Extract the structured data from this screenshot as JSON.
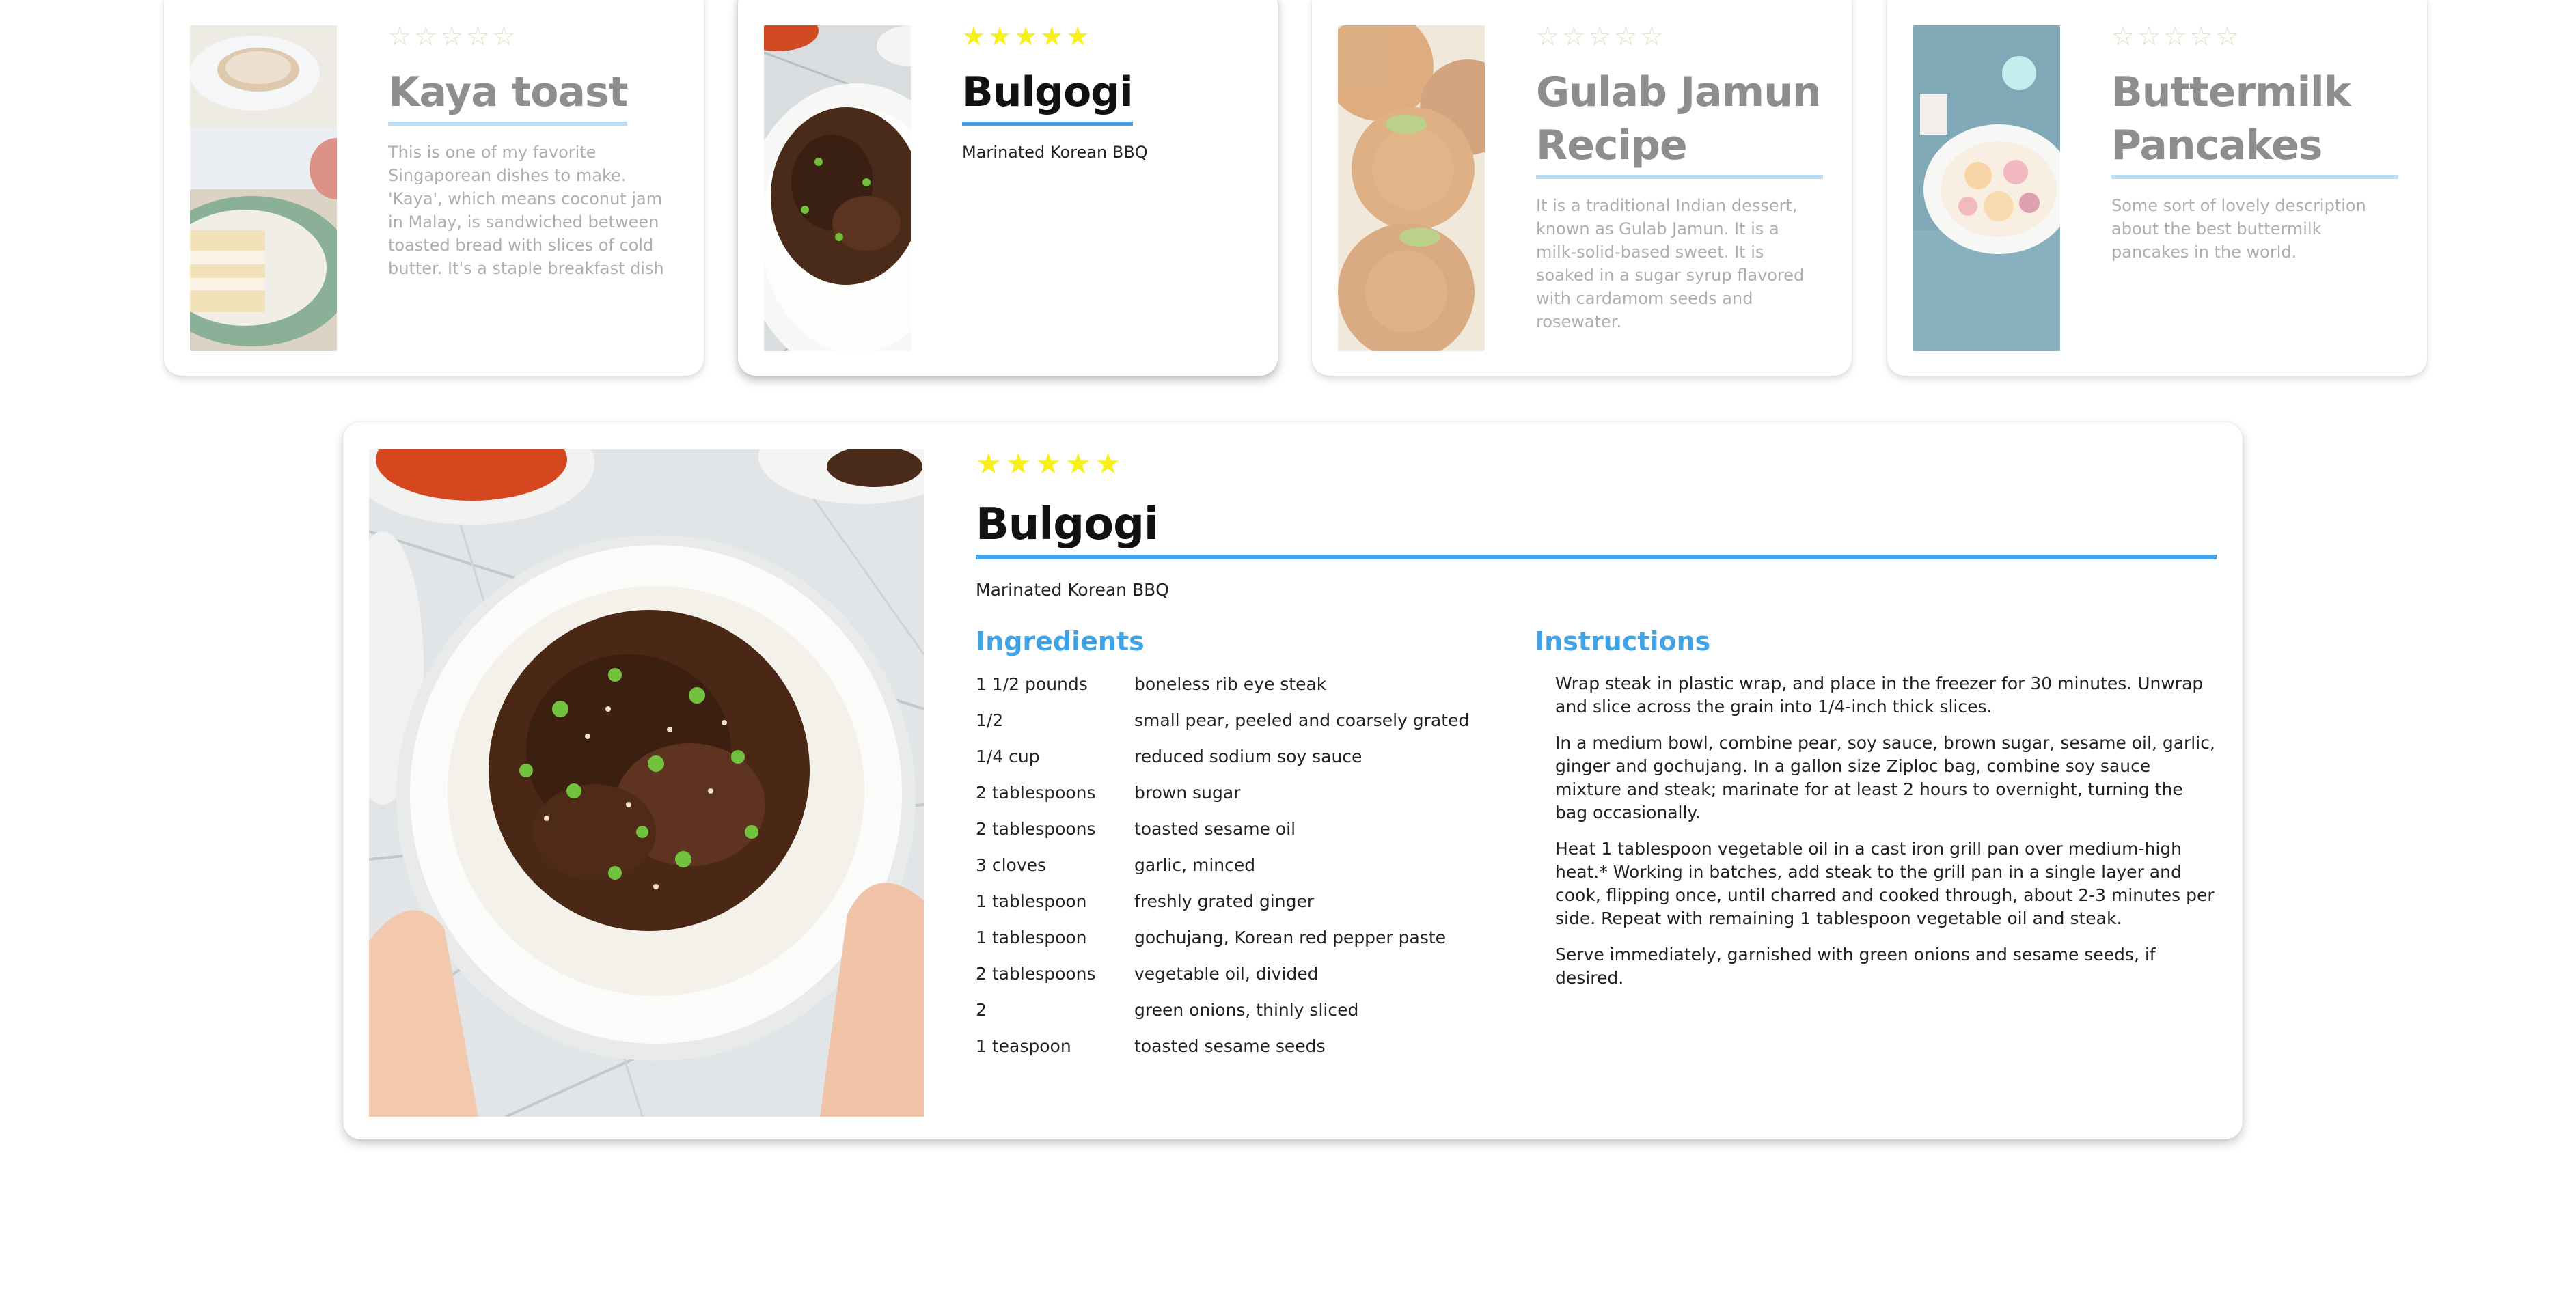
{
  "cards": [
    {
      "title": "Kaya toast",
      "rating": 0,
      "description": "This is one of my favorite Singaporean dishes to make. 'Kaya', which means coconut jam in Malay, is sandwiched between toasted bread with slices of cold butter. It's a staple breakfast dish in Singapore and Malaysia, typically served with",
      "image": "kaya-toast-photo"
    },
    {
      "title": "Bulgogi",
      "rating": 5,
      "description": "Marinated Korean BBQ",
      "image": "bulgogi-photo"
    },
    {
      "title": "Gulab Jamun Recipe",
      "rating": 0,
      "description": "It is a traditional Indian dessert, known as Gulab Jamun. It is a milk-solid-based sweet. It is soaked in a sugar syrup flavored with cardamom seeds and rosewater.",
      "image": "gulab-jamun-photo"
    },
    {
      "title": "Buttermilk Pancakes",
      "rating": 0,
      "description": "Some sort of lovely description about the best buttermilk pancakes in the world.",
      "image": "pancakes-photo"
    }
  ],
  "detail": {
    "title": "Bulgogi",
    "rating": 5,
    "subtitle": "Marinated Korean BBQ",
    "ingredients_heading": "Ingredients",
    "instructions_heading": "Instructions",
    "ingredients": [
      {
        "qty": "1 1/2 pounds",
        "item": "boneless rib eye steak"
      },
      {
        "qty": "1/2",
        "item": "small pear, peeled and coarsely grated"
      },
      {
        "qty": "1/4 cup",
        "item": "reduced sodium soy sauce"
      },
      {
        "qty": "2 tablespoons",
        "item": "brown sugar"
      },
      {
        "qty": "2 tablespoons",
        "item": "toasted sesame oil"
      },
      {
        "qty": "3 cloves",
        "item": "garlic, minced"
      },
      {
        "qty": "1 tablespoon",
        "item": "freshly grated ginger"
      },
      {
        "qty": "1 tablespoon",
        "item": "gochujang, Korean red pepper paste"
      },
      {
        "qty": "2 tablespoons",
        "item": "vegetable oil, divided"
      },
      {
        "qty": "2",
        "item": "green onions, thinly sliced"
      },
      {
        "qty": "1 teaspoon",
        "item": "toasted sesame seeds"
      }
    ],
    "instructions": [
      "Wrap steak in plastic wrap, and place in the freezer for 30 minutes. Unwrap and slice across the grain into 1/4-inch thick slices.",
      "In a medium bowl, combine pear, soy sauce, brown sugar, sesame oil, garlic, ginger and gochujang. In a gallon size Ziploc bag, combine soy sauce mixture and steak; marinate for at least 2 hours to overnight, turning the bag occasionally.",
      "Heat 1 tablespoon vegetable oil in a cast iron grill pan over medium-high heat.* Working in batches, add steak to the grill pan in a single layer and cook, flipping once, until charred and cooked through, about 2-3 minutes per side. Repeat with remaining 1 tablespoon vegetable oil and steak.",
      "Serve immediately, garnished with green onions and sesame seeds, if desired."
    ]
  },
  "colors": {
    "accent": "#4aa3e4",
    "heading": "#3fa3e6",
    "star_on": "#f7f019",
    "star_off": "#cfd0a0"
  }
}
